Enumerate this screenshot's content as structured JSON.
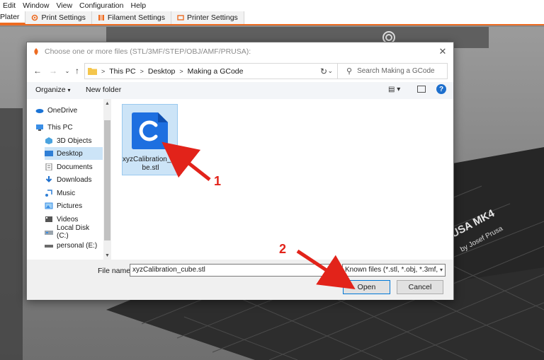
{
  "menubar": {
    "items": [
      "Edit",
      "Window",
      "View",
      "Configuration",
      "Help"
    ]
  },
  "tabs": [
    {
      "label": "Plater",
      "icon": "plater-icon"
    },
    {
      "label": "Print Settings",
      "icon": "gear-icon"
    },
    {
      "label": "Filament Settings",
      "icon": "filament-icon"
    },
    {
      "label": "Printer Settings",
      "icon": "printer-icon"
    }
  ],
  "bed": {
    "brand_text": "USA MK4",
    "sub_text": "by Josef Prusa"
  },
  "dialog": {
    "title": "Choose one or more files (STL/3MF/STEP/OBJ/AMF/PRUSA):",
    "breadcrumb": [
      "This PC",
      "Desktop",
      "Making a GCode"
    ],
    "search_placeholder": "Search Making a GCode",
    "toolbar": {
      "organize": "Organize",
      "new_folder": "New folder"
    },
    "nav": [
      {
        "label": "OneDrive",
        "icon": "cloud-icon",
        "indent": false,
        "selected": false
      },
      {
        "label": "This PC",
        "icon": "computer-icon",
        "indent": false,
        "selected": false
      },
      {
        "label": "3D Objects",
        "icon": "cube-icon",
        "indent": true,
        "selected": false
      },
      {
        "label": "Desktop",
        "icon": "desktop-icon",
        "indent": true,
        "selected": true
      },
      {
        "label": "Documents",
        "icon": "document-icon",
        "indent": true,
        "selected": false
      },
      {
        "label": "Downloads",
        "icon": "download-icon",
        "indent": true,
        "selected": false
      },
      {
        "label": "Music",
        "icon": "music-icon",
        "indent": true,
        "selected": false
      },
      {
        "label": "Pictures",
        "icon": "picture-icon",
        "indent": true,
        "selected": false
      },
      {
        "label": "Videos",
        "icon": "video-icon",
        "indent": true,
        "selected": false
      },
      {
        "label": "Local Disk (C:)",
        "icon": "disk-icon",
        "indent": true,
        "selected": false
      },
      {
        "label": "personal (E:)",
        "icon": "drive-icon",
        "indent": true,
        "selected": false
      }
    ],
    "file": {
      "name": "xyzCalibration_cube.stl",
      "icon": "cura-file-icon"
    },
    "filename_label": "File name:",
    "filename_value": "xyzCalibration_cube.stl",
    "filetype_value": "Known files (*.stl, *.obj, *.3mf, *",
    "open_label": "Open",
    "cancel_label": "Cancel"
  },
  "annotations": {
    "one": "1",
    "two": "2",
    "color": "#e2231a"
  },
  "colors": {
    "accent": "#ed6b21",
    "selection": "#cce4f7",
    "file_icon": "#1d6fe0"
  }
}
